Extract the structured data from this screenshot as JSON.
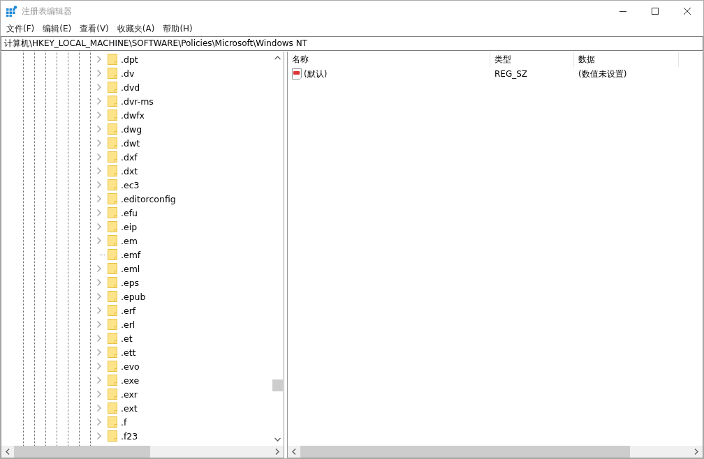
{
  "window": {
    "title": "注册表编辑器"
  },
  "menu": [
    "文件(F)",
    "编辑(E)",
    "查看(V)",
    "收藏夹(A)",
    "帮助(H)"
  ],
  "address": "计算机\\HKEY_LOCAL_MACHINE\\SOFTWARE\\Policies\\Microsoft\\Windows NT",
  "tree": [
    {
      "label": ".dpt",
      "has_children": true
    },
    {
      "label": ".dv",
      "has_children": true
    },
    {
      "label": ".dvd",
      "has_children": true
    },
    {
      "label": ".dvr-ms",
      "has_children": true
    },
    {
      "label": ".dwfx",
      "has_children": true
    },
    {
      "label": ".dwg",
      "has_children": true
    },
    {
      "label": ".dwt",
      "has_children": true
    },
    {
      "label": ".dxf",
      "has_children": true
    },
    {
      "label": ".dxt",
      "has_children": true
    },
    {
      "label": ".ec3",
      "has_children": true
    },
    {
      "label": ".editorconfig",
      "has_children": true
    },
    {
      "label": ".efu",
      "has_children": true
    },
    {
      "label": ".eip",
      "has_children": true
    },
    {
      "label": ".em",
      "has_children": true
    },
    {
      "label": ".emf",
      "has_children": false
    },
    {
      "label": ".eml",
      "has_children": true
    },
    {
      "label": ".eps",
      "has_children": true
    },
    {
      "label": ".epub",
      "has_children": true
    },
    {
      "label": ".erf",
      "has_children": true
    },
    {
      "label": ".erl",
      "has_children": true
    },
    {
      "label": ".et",
      "has_children": true
    },
    {
      "label": ".ett",
      "has_children": true
    },
    {
      "label": ".evo",
      "has_children": true
    },
    {
      "label": ".exe",
      "has_children": true
    },
    {
      "label": ".exr",
      "has_children": true
    },
    {
      "label": ".ext",
      "has_children": true
    },
    {
      "label": ".f",
      "has_children": true
    },
    {
      "label": ".f23",
      "has_children": true
    }
  ],
  "values": {
    "columns": [
      "名称",
      "类型",
      "数据"
    ],
    "rows": [
      {
        "name": "(默认)",
        "type": "REG_SZ",
        "data": "(数值未设置)"
      }
    ]
  }
}
